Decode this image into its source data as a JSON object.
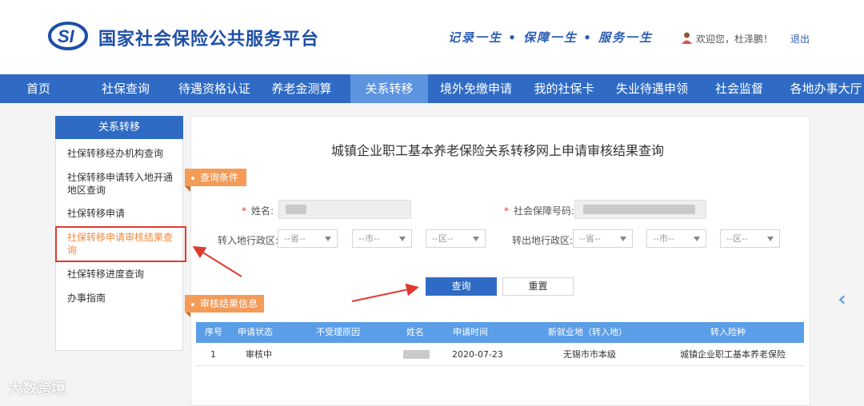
{
  "header": {
    "site_title": "国家社会保险公共服务平台",
    "slogan": "记录一生 • 保障一生 • 服务一生",
    "welcome": "欢迎您，杜泽鹏！",
    "logout": "退出",
    "brand_color": "#1e4fa8"
  },
  "nav": {
    "items": [
      {
        "label": "首页"
      },
      {
        "label": "社保查询"
      },
      {
        "label": "待遇资格认证"
      },
      {
        "label": "养老金测算"
      },
      {
        "label": "关系转移"
      },
      {
        "label": "境外免缴申请"
      },
      {
        "label": "我的社保卡"
      },
      {
        "label": "失业待遇申领"
      },
      {
        "label": "社会监督"
      },
      {
        "label": "各地办事大厅"
      }
    ],
    "active_index": 4,
    "bar_color": "#2f6bc4",
    "active_color": "#5c94e0"
  },
  "sidebar": {
    "title": "关系转移",
    "items": [
      {
        "label": "社保转移经办机构查询"
      },
      {
        "label_line1": "社保转移申请转入地开通",
        "label_line2": "地区查询"
      },
      {
        "label": "社保转移申请"
      },
      {
        "label_line1": "社保转移申请审核结果查",
        "label_line2": "询"
      },
      {
        "label": "社保转移进度查询"
      },
      {
        "label": "办事指南"
      }
    ],
    "current_index": 3
  },
  "main": {
    "title": "城镇企业职工基本养老保险关系转移网上申请审核结果查询",
    "query_tag": "查询条件",
    "result_tag": "审核结果信息",
    "form": {
      "name_label": "姓名:",
      "ssn_label": "社会保障号码:",
      "in_region_label": "转入地行政区:",
      "out_region_label": "转出地行政区:",
      "province_placeholder": "--省--",
      "city_placeholder": "--市--",
      "district_placeholder": "--区--"
    },
    "buttons": {
      "query": "查询",
      "reset": "重置"
    }
  },
  "table": {
    "headers": [
      "序号",
      "申请状态",
      "不受理原因",
      "姓名",
      "申请时间",
      "新就业地（转入地）",
      "转入险种"
    ],
    "rows": [
      {
        "index": "1",
        "status": "审核中",
        "reason": "",
        "date": "2020-07-23",
        "new_location": "无锡市市本级",
        "insurance": "城镇企业职工基本养老保险"
      }
    ],
    "header_color": "#5b9ee8"
  },
  "watermark": "大数跨境"
}
